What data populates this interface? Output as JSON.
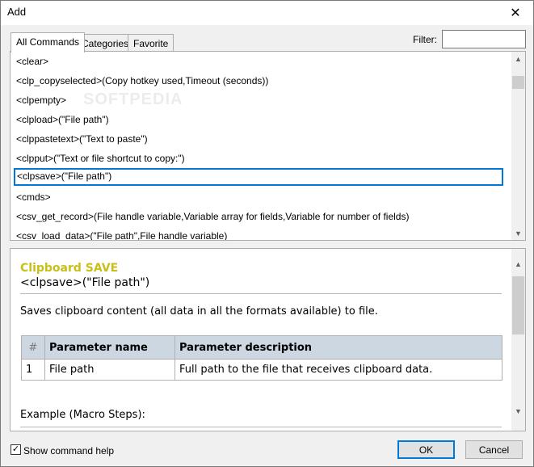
{
  "window": {
    "title": "Add",
    "close_glyph": "✕"
  },
  "tabs": [
    {
      "label": "All Commands",
      "active": true
    },
    {
      "label": "Categories",
      "active": false
    },
    {
      "label": "Favorite",
      "active": false
    }
  ],
  "filter": {
    "label": "Filter:",
    "value": ""
  },
  "watermark": "SOFTPEDIA",
  "commands": [
    "<clear>",
    "<clp_copyselected>(Copy hotkey used,Timeout (seconds))",
    "<clpempty>",
    "<clpload>(\"File path\")",
    "<clppastetext>(\"Text to paste\")",
    "<clpput>(\"Text or file shortcut to copy:\")",
    "<clpsave>(\"File path\")",
    "<cmds>",
    "<csv_get_record>(File handle variable,Variable array for fields,Variable for number of fields)",
    "<csv_load_data>(\"File path\",File handle variable)"
  ],
  "selected_command": "<clpsave>(\"File path\")",
  "help": {
    "title": "Clipboard SAVE",
    "signature": "<clpsave>(\"File path\")",
    "description": "Saves clipboard content (all data in all the formats available) to file.",
    "table_headers": {
      "num": "#",
      "name": "Parameter name",
      "desc": "Parameter description"
    },
    "params": [
      {
        "num": "1",
        "name": "File path",
        "desc": "Full path to the file that receives clipboard data."
      }
    ],
    "example_label": "Example (Macro Steps):",
    "title_color": "#c8c018"
  },
  "footer": {
    "show_help_label": "Show command help",
    "show_help_checked": true,
    "check_glyph": "✓",
    "ok_label": "OK",
    "cancel_label": "Cancel"
  },
  "scroll_glyphs": {
    "up": "▲",
    "down": "▼"
  }
}
